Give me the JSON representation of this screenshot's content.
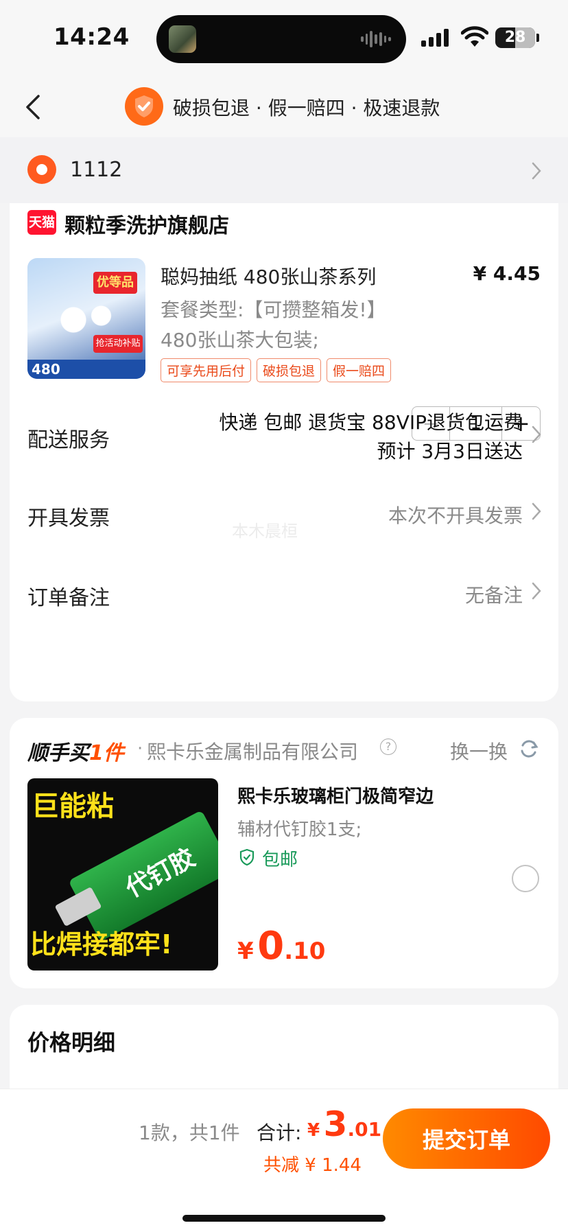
{
  "status_bar": {
    "time": "14:24",
    "battery": "28"
  },
  "header": {
    "title": "破损包退 · 假一赔四 · 极速退款"
  },
  "address": {
    "text": "1112"
  },
  "shop": {
    "badge": "天猫",
    "name": "颗粒季洗护旗舰店"
  },
  "product": {
    "image_badge": "优等品",
    "image_badge2": "抢活动补贴",
    "image_count": "480",
    "name": "聪妈抽纸 480张山茶系列",
    "price": "¥ 4.45",
    "option_line1": "套餐类型:【可攒整箱发!】",
    "option_line2": "480张山茶大包装;",
    "tags": [
      "可享先用后付",
      "破损包退",
      "假一赔四"
    ],
    "quantity": "1",
    "minus": "−",
    "plus": "+"
  },
  "rows": {
    "delivery_label": "配送服务",
    "delivery_line1": "快递 包邮 退货宝 88VIP退货包运费",
    "delivery_line2": "预计 3月3日送达",
    "invoice_label": "开具发票",
    "invoice_value": "本次不开具发票",
    "note_label": "订单备注",
    "note_value": "无备注"
  },
  "watermark": "本木晨桓",
  "addon": {
    "title_a": "顺手买",
    "title_b": "1件",
    "company": "熙卡乐金属制品有限公司",
    "help": "?",
    "swap_label": "换一换",
    "image_text_top": "巨能粘",
    "image_text_tube": "代钉胶",
    "image_text_bottom": "比焊接都牢!",
    "name": "熙卡乐玻璃柜门极简窄边",
    "spec": "辅材代钉胶1支;",
    "shipping": "包邮",
    "price_symbol": "¥",
    "price_int": "0",
    "price_dec": ".10"
  },
  "price_detail": {
    "title": "价格明细"
  },
  "bottom": {
    "count": "1款，共1件",
    "total_label": "合计:",
    "price_symbol": "¥",
    "price_int": "3",
    "price_dec": ".01",
    "saved": "共减 ¥ 1.44",
    "submit": "提交订单"
  },
  "colors": {
    "accent": "#ff5000",
    "price": "#ff3a10",
    "free_ship": "#1a9a5a"
  }
}
